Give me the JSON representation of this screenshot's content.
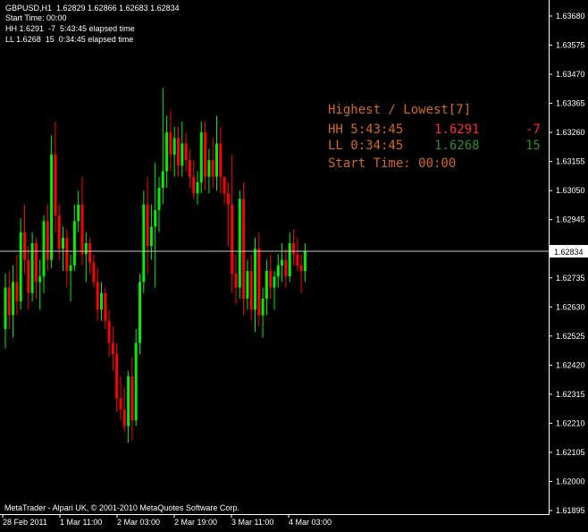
{
  "header": {
    "symbol_line": "GBPUSD,H1  1.62829 1.62866 1.62683 1.62834",
    "start_time": "Start Time: 00:00",
    "hh_line": "HH 1.6291  -7  5:43:45 elapsed time",
    "ll_line": "LL 1.6268  15  0:34:45 elapsed time"
  },
  "panel": {
    "title": "Highest / Lowest[7]",
    "hh_label": "HH 5:43:45",
    "hh_price": "1.6291",
    "hh_delta": "-7",
    "ll_label": "LL 0:34:45",
    "ll_price": "1.6268",
    "ll_delta": "15",
    "start_time": "Start Time: 00:00"
  },
  "copyright": "MetaTrader - Alpari UK, © 2001-2010 MetaQuotes Software Corp.",
  "colors": {
    "background": "#000000",
    "axis": "#ffffff",
    "bull": "#00ee00",
    "bear": "#ff0000",
    "panel_text": "#d2691e",
    "hh": "#ff2a2a",
    "ll": "#2e8b22"
  },
  "chart_data": {
    "type": "candlestick",
    "symbol": "GBPUSD",
    "timeframe": "H1",
    "current_price": "1.62834",
    "y_tick_labels": [
      "1.63680",
      "1.63575",
      "1.63470",
      "1.63365",
      "1.63260",
      "1.63155",
      "1.63050",
      "1.62945",
      "1.62840",
      "1.62735",
      "1.62630",
      "1.62525",
      "1.62420",
      "1.62315",
      "1.62210",
      "1.62105",
      "1.62000",
      "1.61895"
    ],
    "x_tick_labels": [
      "28 Feb 2011",
      "1 Mar 11:00",
      "2 Mar 03:00",
      "2 Mar 19:00",
      "3 Mar 11:00",
      "4 Mar 03:00"
    ],
    "ylim": [
      1.61895,
      1.6368
    ],
    "candles": [
      [
        1.6255,
        1.6275,
        1.6248,
        1.627
      ],
      [
        1.627,
        1.6276,
        1.6255,
        1.626
      ],
      [
        1.626,
        1.6278,
        1.6252,
        1.6272
      ],
      [
        1.6272,
        1.6282,
        1.626,
        1.6265
      ],
      [
        1.6265,
        1.6295,
        1.6262,
        1.629
      ],
      [
        1.629,
        1.63,
        1.6275,
        1.628
      ],
      [
        1.628,
        1.6285,
        1.6262,
        1.6268
      ],
      [
        1.6268,
        1.629,
        1.6265,
        1.6286
      ],
      [
        1.6286,
        1.6288,
        1.6266,
        1.6272
      ],
      [
        1.6272,
        1.628,
        1.6262,
        1.6274
      ],
      [
        1.6274,
        1.6296,
        1.6268,
        1.6294
      ],
      [
        1.6294,
        1.63,
        1.6276,
        1.628
      ],
      [
        1.628,
        1.6325,
        1.6277,
        1.6318
      ],
      [
        1.6318,
        1.633,
        1.629,
        1.6296
      ],
      [
        1.6296,
        1.63,
        1.628,
        1.6284
      ],
      [
        1.6284,
        1.6292,
        1.6276,
        1.6288
      ],
      [
        1.6288,
        1.6291,
        1.627,
        1.6276
      ],
      [
        1.6276,
        1.6282,
        1.6265,
        1.6278
      ],
      [
        1.6278,
        1.63,
        1.6276,
        1.6294
      ],
      [
        1.6294,
        1.6305,
        1.629,
        1.63
      ],
      [
        1.63,
        1.631,
        1.6278,
        1.6282
      ],
      [
        1.6282,
        1.629,
        1.6272,
        1.6286
      ],
      [
        1.6286,
        1.6288,
        1.6275,
        1.6279
      ],
      [
        1.6279,
        1.6282,
        1.627,
        1.6272
      ],
      [
        1.6272,
        1.6277,
        1.6258,
        1.6262
      ],
      [
        1.6262,
        1.6272,
        1.6258,
        1.6268
      ],
      [
        1.6268,
        1.627,
        1.6255,
        1.6258
      ],
      [
        1.6258,
        1.6262,
        1.6245,
        1.625
      ],
      [
        1.625,
        1.6256,
        1.624,
        1.6246
      ],
      [
        1.6246,
        1.625,
        1.6225,
        1.623
      ],
      [
        1.623,
        1.6238,
        1.6222,
        1.6226
      ],
      [
        1.6226,
        1.6234,
        1.6218,
        1.622
      ],
      [
        1.622,
        1.624,
        1.6214,
        1.6238
      ],
      [
        1.6238,
        1.6245,
        1.6215,
        1.6222
      ],
      [
        1.6222,
        1.6255,
        1.622,
        1.625
      ],
      [
        1.625,
        1.6275,
        1.6246,
        1.6272
      ],
      [
        1.6272,
        1.6305,
        1.6268,
        1.63
      ],
      [
        1.63,
        1.631,
        1.6275,
        1.6285
      ],
      [
        1.6285,
        1.63,
        1.628,
        1.6292
      ],
      [
        1.6292,
        1.6315,
        1.627,
        1.6298
      ],
      [
        1.6298,
        1.631,
        1.629,
        1.6306
      ],
      [
        1.6306,
        1.6342,
        1.63,
        1.6312
      ],
      [
        1.6312,
        1.6332,
        1.6306,
        1.6326
      ],
      [
        1.6326,
        1.6334,
        1.6312,
        1.6318
      ],
      [
        1.6318,
        1.6328,
        1.631,
        1.6324
      ],
      [
        1.6324,
        1.6328,
        1.631,
        1.6314
      ],
      [
        1.6314,
        1.633,
        1.631,
        1.6322
      ],
      [
        1.6322,
        1.6326,
        1.6312,
        1.6316
      ],
      [
        1.6316,
        1.632,
        1.6306,
        1.631
      ],
      [
        1.631,
        1.6316,
        1.6302,
        1.6304
      ],
      [
        1.6304,
        1.6312,
        1.63,
        1.6308
      ],
      [
        1.6308,
        1.633,
        1.6304,
        1.6326
      ],
      [
        1.6326,
        1.633,
        1.6305,
        1.631
      ],
      [
        1.631,
        1.632,
        1.6304,
        1.6316
      ],
      [
        1.6316,
        1.6324,
        1.6306,
        1.631
      ],
      [
        1.631,
        1.6332,
        1.6305,
        1.6322
      ],
      [
        1.6322,
        1.6328,
        1.6304,
        1.631
      ],
      [
        1.631,
        1.6308,
        1.63,
        1.6304
      ],
      [
        1.6304,
        1.6308,
        1.6285,
        1.63
      ],
      [
        1.63,
        1.6318,
        1.6268,
        1.6275
      ],
      [
        1.6275,
        1.6282,
        1.6264,
        1.627
      ],
      [
        1.627,
        1.6305,
        1.6266,
        1.6302
      ],
      [
        1.6302,
        1.6308,
        1.626,
        1.6266
      ],
      [
        1.6266,
        1.628,
        1.6262,
        1.6276
      ],
      [
        1.6276,
        1.6282,
        1.6258,
        1.6262
      ],
      [
        1.6262,
        1.6288,
        1.6254,
        1.6284
      ],
      [
        1.6284,
        1.629,
        1.6256,
        1.626
      ],
      [
        1.626,
        1.627,
        1.6252,
        1.6266
      ],
      [
        1.6266,
        1.628,
        1.626,
        1.6276
      ],
      [
        1.6276,
        1.6282,
        1.6266,
        1.627
      ],
      [
        1.627,
        1.6276,
        1.6262,
        1.6274
      ],
      [
        1.6274,
        1.6282,
        1.627,
        1.6278
      ],
      [
        1.6278,
        1.6286,
        1.6272,
        1.628
      ],
      [
        1.628,
        1.6284,
        1.627,
        1.6274
      ],
      [
        1.6274,
        1.629,
        1.6272,
        1.6286
      ],
      [
        1.6286,
        1.6291,
        1.6278,
        1.6282
      ],
      [
        1.6282,
        1.6288,
        1.6276,
        1.6278
      ],
      [
        1.6278,
        1.6282,
        1.6268,
        1.6276
      ],
      [
        1.6276,
        1.6286,
        1.6272,
        1.6283
      ]
    ]
  }
}
